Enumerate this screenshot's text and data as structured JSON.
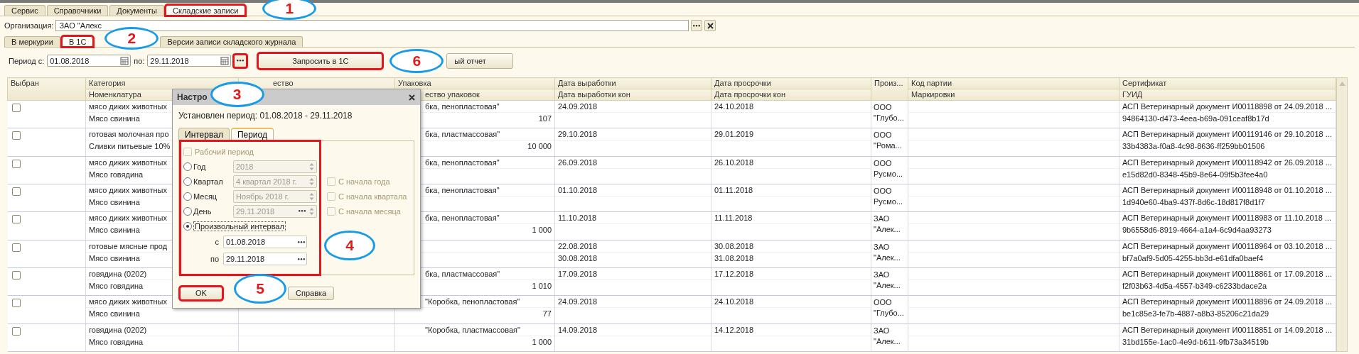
{
  "main_tabs": [
    {
      "label": "Сервис",
      "selected": false,
      "highlighted": false
    },
    {
      "label": "Справочники",
      "selected": false,
      "highlighted": false
    },
    {
      "label": "Документы",
      "selected": false,
      "highlighted": false
    },
    {
      "label": "Складские записи",
      "selected": true,
      "highlighted": true,
      "callout": "1"
    }
  ],
  "organization": {
    "label": "Организация:",
    "value": "ЗАО \"Алекс"
  },
  "sub_tabs": [
    {
      "label": "В меркурии",
      "selected": false,
      "highlighted": false
    },
    {
      "label": "В 1С",
      "selected": true,
      "highlighted": true,
      "callout": "2"
    },
    {
      "label": "Версии записи складского журнала",
      "selected": false,
      "highlighted": false
    }
  ],
  "period_bar": {
    "from_label": "Период с:",
    "from": "01.08.2018",
    "to_label": "по:",
    "to": "29.11.2018",
    "picker_button": {
      "highlighted": true
    },
    "buttons": [
      {
        "label": "Запросить в 1С",
        "highlighted": true
      },
      {
        "label": "ый отчет",
        "highlighted": false,
        "callout": "6"
      }
    ]
  },
  "table": {
    "columns": [
      {
        "title": "Выбран"
      },
      {
        "title": "Категория",
        "subtitle": "Номенклатура"
      },
      {
        "title": "ество"
      },
      {
        "title": "Упаковка",
        "subtitle": "ество упаковок"
      },
      {
        "title": "Дата выработки",
        "subtitle": "Дата выработки кон"
      },
      {
        "title": "Дата просрочки",
        "subtitle": "Дата просрочки кон"
      },
      {
        "title": "Произ..."
      },
      {
        "title": "Код партии",
        "subtitle": "Маркировки"
      },
      {
        "title": "Сертификат",
        "subtitle": "ГУИД"
      }
    ],
    "rows": [
      {
        "checked": false,
        "category": "мясо диких животных",
        "nomenclature": "Мясо свинина",
        "packaging": "бка, пенопластовая\"",
        "quantity": "107",
        "produced": "24.09.2018",
        "expires": "24.10.2018",
        "producer": "ООО \"Глубо...",
        "certificate": "АСП Ветеринарный документ И00118898 от 24.09.2018 ...",
        "guid": "94864130-d473-4eea-b69a-091ceaf8b17d"
      },
      {
        "checked": false,
        "category": "готовая молочная про",
        "nomenclature": "Сливки питьевые 10%",
        "packaging": "бка, пластмассовая\"",
        "quantity": "10 000",
        "produced": "29.10.2018",
        "expires": "29.01.2019",
        "producer": "ООО \"Рома...",
        "certificate": "АСП Ветеринарный документ И00119146 от 29.10.2018 ...",
        "guid": "33b4383a-f0a8-4c98-8636-ff259bb01506"
      },
      {
        "checked": false,
        "category": "мясо диких животных",
        "nomenclature": "Мясо говядина",
        "packaging": "бка, пенопластовая\"",
        "produced": "26.09.2018",
        "expires": "26.10.2018",
        "producer": "ООО Русмо...",
        "certificate": "АСП Ветеринарный документ И00118942 от 26.09.2018 ...",
        "guid": "e15d82d0-8348-45b9-8e64-09f5b3fee4a0"
      },
      {
        "checked": false,
        "category": "мясо диких животных",
        "nomenclature": "Мясо свинина",
        "packaging": "бка, пенопластовая\"",
        "produced": "01.10.2018",
        "expires": "01.11.2018",
        "producer": "ООО Русмо...",
        "certificate": "АСП Ветеринарный документ И00118948 от 01.10.2018 ...",
        "guid": "1d940e60-4ba9-437f-8d6c-18d817f8d1f7"
      },
      {
        "checked": false,
        "category": "мясо диких животных",
        "nomenclature": "Мясо свинина",
        "packaging": "бка, пенопластовая\"",
        "quantity": "1 000",
        "produced": "11.10.2018",
        "expires": "11.11.2018",
        "producer": "ЗАО \"Алек...",
        "certificate": "АСП Ветеринарный документ И00118983 от 11.10.2018 ...",
        "guid": "9b6558d6-8919-4664-a1a4-6c9d4aa93273"
      },
      {
        "checked": false,
        "category": "готовые мясные прод",
        "nomenclature": "Мясо свинина",
        "produced": "22.08.2018",
        "produced_end": "30.08.2018",
        "expires": "30.08.2018",
        "expires_end": "31.08.2018",
        "producer": "ЗАО \"Алек...",
        "certificate": "АСП Ветеринарный документ И00118964 от 03.10.2018 ...",
        "guid": "bf7a0af9-5d05-4255-bb3d-e61dfa0baef4"
      },
      {
        "checked": false,
        "category": "говядина (0202)",
        "nomenclature": "Мясо говядина",
        "packaging": "бка, пластмассовая\"",
        "quantity": "1 010",
        "produced": "17.09.2018",
        "expires": "17.12.2018",
        "producer": "ЗАО \"Алек...",
        "certificate": "АСП Ветеринарный документ И00118861 от 17.09.2018 ...",
        "guid": "f2f03b63-4d5a-4557-b349-c6233bdace2a"
      },
      {
        "checked": false,
        "category": "мясо диких животных",
        "nomenclature": "Мясо свинина",
        "packaging": "\"Коробка, пенопластовая\"",
        "quantity": "77",
        "produced": "24.09.2018",
        "expires": "24.10.2018",
        "producer": "ООО \"Глубо...",
        "certificate": "АСП Ветеринарный документ И00118896 от 24.09.2018 ...",
        "guid": "be1c85e3-fe7b-4887-a8b3-85206c21da29"
      },
      {
        "checked": false,
        "category": "говядина (0202)",
        "nomenclature": "Мясо говядина",
        "packaging": "\"Коробка, пластмассовая\"",
        "quantity": "1 000",
        "produced": "14.09.2018",
        "expires": "14.12.2018",
        "producer": "ЗАО \"Алек...",
        "certificate": "АСП Ветеринарный документ И00118851 от 14.09.2018 ...",
        "guid": "31bd155e-1ac0-4e9d-b611-9fb73a34519b"
      }
    ]
  },
  "dialog": {
    "title": "Настро",
    "callout": "3",
    "summary": "Установлен период: 01.08.2018 - 29.11.2018",
    "tabs": [
      {
        "label": "Интервал",
        "selected": false
      },
      {
        "label": "Период",
        "selected": true
      }
    ],
    "period_group": {
      "highlighted": true,
      "callout": "4",
      "working_period": {
        "label": "Рабочий период",
        "checked": false,
        "disabled": true
      },
      "options": [
        {
          "label": "Год",
          "selected": false,
          "value": "2018"
        },
        {
          "label": "Квартал",
          "selected": false,
          "value": "4 квартал 2018 г.",
          "checkbox": {
            "label": "С начала года",
            "checked": false
          }
        },
        {
          "label": "Месяц",
          "selected": false,
          "value": "Ноябрь 2018 г.",
          "checkbox": {
            "label": "С начала квартала",
            "checked": false
          }
        },
        {
          "label": "День",
          "selected": false,
          "value": "29.11.2018",
          "picker": true,
          "checkbox": {
            "label": "С начала месяца",
            "checked": false
          }
        },
        {
          "label": "Произвольный интервал",
          "selected": true
        }
      ],
      "interval": [
        {
          "label": "с",
          "value": "01.08.2018"
        },
        {
          "label": "по",
          "value": "29.11.2018"
        }
      ]
    },
    "buttons": [
      {
        "label": "OK",
        "highlighted": true,
        "callout": "5"
      },
      {
        "label": "Справка",
        "highlighted": false
      }
    ]
  }
}
